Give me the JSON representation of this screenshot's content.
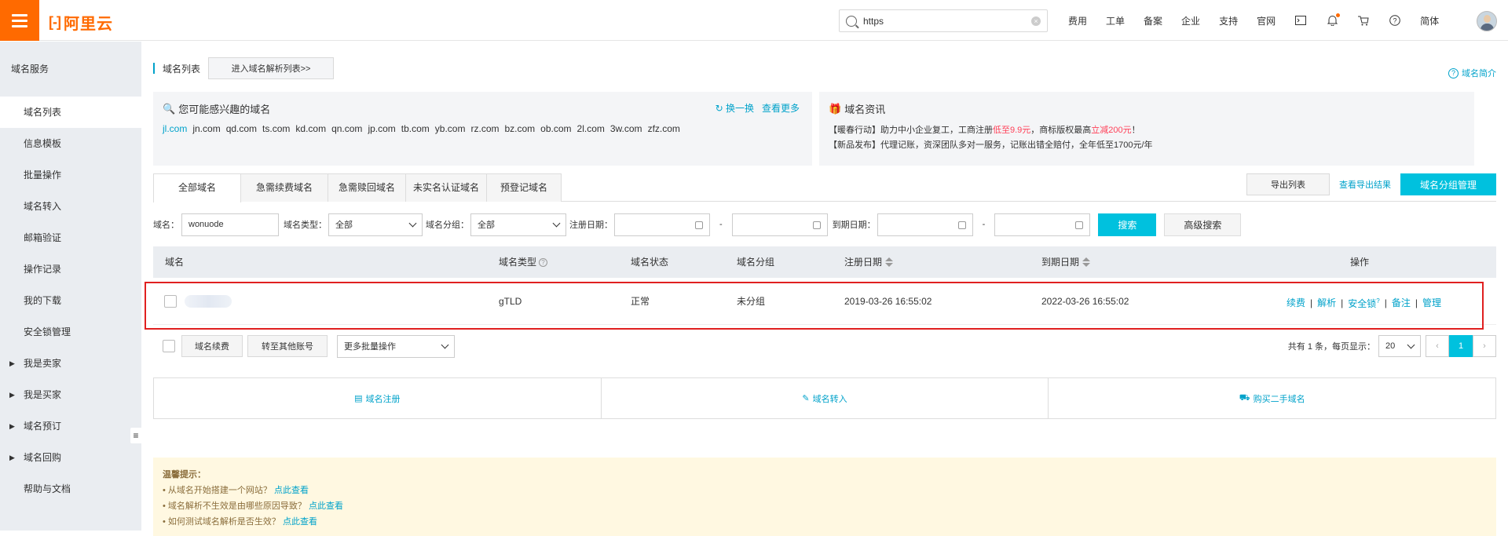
{
  "topbar": {
    "brand": "阿里云",
    "brand_mark": "[-]",
    "search_value": "https",
    "nav": [
      "费用",
      "工单",
      "备案",
      "企业",
      "支持",
      "官网"
    ],
    "lang": "简体"
  },
  "sidebar": {
    "title": "域名服务",
    "items": [
      {
        "label": "域名列表",
        "active": true
      },
      {
        "label": "信息模板"
      },
      {
        "label": "批量操作"
      },
      {
        "label": "域名转入"
      },
      {
        "label": "邮箱验证"
      },
      {
        "label": "操作记录"
      },
      {
        "label": "我的下载"
      },
      {
        "label": "安全锁管理"
      },
      {
        "label": "我是卖家",
        "expandable": true
      },
      {
        "label": "我是买家",
        "expandable": true
      },
      {
        "label": "域名预订",
        "expandable": true
      },
      {
        "label": "域名回购",
        "expandable": true
      },
      {
        "label": "帮助与文档"
      }
    ]
  },
  "header": {
    "title": "域名列表",
    "goto_dns_button": "进入域名解析列表>>",
    "help_link": "域名简介"
  },
  "interest_card": {
    "title": "您可能感兴趣的域名",
    "refresh": "换一换",
    "more": "查看更多",
    "domains": [
      "jl.com",
      "jn.com",
      "qd.com",
      "ts.com",
      "kd.com",
      "qn.com",
      "jp.com",
      "tb.com",
      "yb.com",
      "rz.com",
      "bz.com",
      "ob.com",
      "2l.com",
      "3w.com",
      "zfz.com"
    ]
  },
  "news_card": {
    "title": "域名资讯",
    "line1_a": "【暖春行动】助力中小企业复工，工商注册",
    "line1_b": "低至9.9元",
    "line1_c": "，商标版权最高",
    "line1_d": "立减200元",
    "line1_e": "！",
    "line2": "【新品发布】代理记账，资深团队多对一服务，记账出错全赔付，全年低至1700元/年"
  },
  "tabs": [
    "全部域名",
    "急需续费域名",
    "急需赎回域名",
    "未实名认证域名",
    "预登记域名"
  ],
  "actions": {
    "export": "导出列表",
    "view_export": "查看导出结果",
    "group_manage": "域名分组管理"
  },
  "filters": {
    "domain_label": "域名：",
    "domain_value": "wonuode",
    "type_label": "域名类型：",
    "type_value": "全部",
    "group_label": "域名分组：",
    "group_value": "全部",
    "reg_label": "注册日期：",
    "exp_label": "到期日期：",
    "dash": "-",
    "search": "搜索",
    "advanced": "高级搜索"
  },
  "table": {
    "headers": {
      "domain": "域名",
      "type": "域名类型",
      "status": "域名状态",
      "group": "域名分组",
      "reg": "注册日期",
      "exp": "到期日期",
      "ops": "操作"
    },
    "rows": [
      {
        "type": "gTLD",
        "status": "正常",
        "group": "未分组",
        "reg": "2019-03-26 16:55:02",
        "exp": "2022-03-26 16:55:02"
      }
    ],
    "ops": {
      "renew": "续费",
      "dns": "解析",
      "lock": "安全锁",
      "note": "备注",
      "manage": "管理",
      "sep": "|"
    }
  },
  "bulk": {
    "renew": "域名续费",
    "transfer": "转至其他账号",
    "more": "更多批量操作"
  },
  "pager": {
    "summary": "共有 1 条，每页显示：",
    "page_size": "20",
    "prev": "‹",
    "current": "1",
    "next": "›"
  },
  "quick": {
    "register": "域名注册",
    "transfer_in": "域名转入",
    "buy_second": "购买二手域名"
  },
  "tips": {
    "title": "温馨提示：",
    "items": [
      {
        "text": "• 从域名开始搭建一个网站？",
        "link": "点此查看"
      },
      {
        "text": "• 域名解析不生效是由哪些原因导致？",
        "link": "点此查看"
      },
      {
        "text": "• 如何测试域名解析是否生效？",
        "link": "点此查看"
      }
    ]
  },
  "colors": {
    "brand": "#ff6a00",
    "accent": "#00c1de",
    "link": "#00a2ca",
    "highlight": "#e02020"
  }
}
